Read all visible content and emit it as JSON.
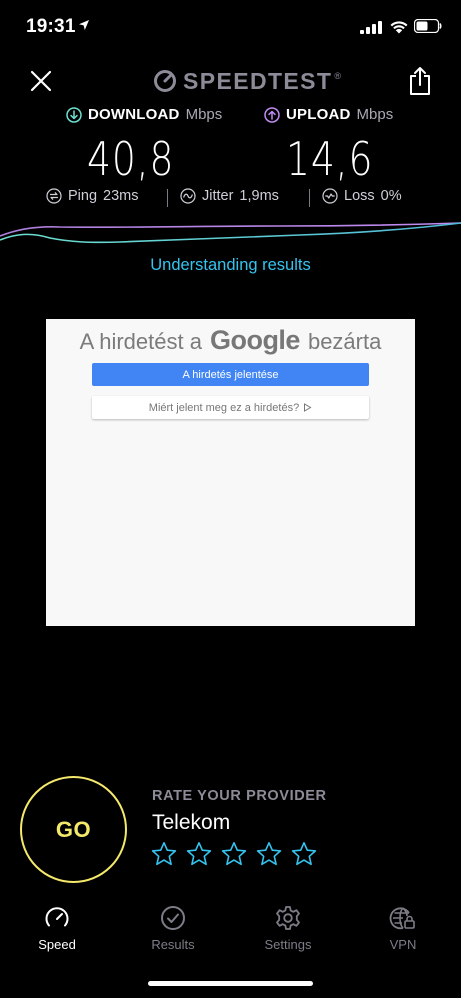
{
  "status_bar": {
    "time": "19:31"
  },
  "header": {
    "logo_text": "SPEEDTEST",
    "logo_trademark": "®"
  },
  "download": {
    "label": "DOWNLOAD",
    "unit": "Mbps",
    "value": "40,8"
  },
  "upload": {
    "label": "UPLOAD",
    "unit": "Mbps",
    "value": "14,6"
  },
  "stats": {
    "ping": {
      "label": "Ping",
      "value": "23",
      "unit": "ms"
    },
    "jitter": {
      "label": "Jitter",
      "value": "1,9",
      "unit": "ms"
    },
    "loss": {
      "label": "Loss",
      "value": "0%"
    }
  },
  "understanding_link": "Understanding results",
  "ad": {
    "title_prefix": "A hirdetést a",
    "title_brand": "Google",
    "title_suffix": "bezárta",
    "report_button": "A hirdetés jelentése",
    "why_button": "Miért jelent meg ez a hirdetés?"
  },
  "go_button": "GO",
  "rating": {
    "title": "RATE YOUR PROVIDER",
    "provider": "Telekom",
    "stars": 5,
    "filled": 0
  },
  "tabs": [
    {
      "label": "Speed",
      "icon": "speedometer-icon",
      "active": true
    },
    {
      "label": "Results",
      "icon": "check-circle-icon",
      "active": false
    },
    {
      "label": "Settings",
      "icon": "gear-icon",
      "active": false
    },
    {
      "label": "VPN",
      "icon": "globe-lock-icon",
      "active": false
    }
  ],
  "colors": {
    "download_accent": "#6ee0cf",
    "upload_accent": "#c08cf2",
    "link": "#35c3ef",
    "go": "#f4e96a",
    "star": "#35c3ef",
    "ad_button": "#4184f3"
  }
}
